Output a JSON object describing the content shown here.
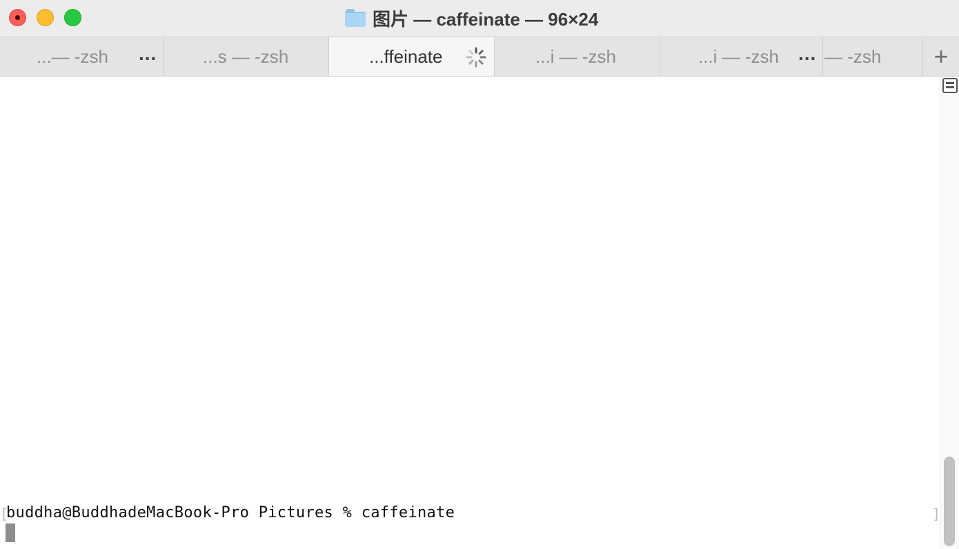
{
  "window": {
    "title": "图片 — caffeinate — 96×24",
    "folder_icon": "folder-icon"
  },
  "tabs": [
    {
      "label": "...— -zsh",
      "overflow": "..."
    },
    {
      "label": "...s — -zsh"
    },
    {
      "label": "...ffeinate",
      "active": true,
      "status_icon": "spinner-icon"
    },
    {
      "label": "...i — -zsh"
    },
    {
      "label": "...i — -zsh",
      "overflow": "..."
    },
    {
      "label": "— -zsh"
    }
  ],
  "new_tab": "+",
  "terminal": {
    "left_bracket": "[",
    "right_bracket": "]",
    "prompt_line": "buddha@BuddhadeMacBook-Pro Pictures % caffeinate"
  },
  "colors": {
    "close": "#ff5f57",
    "minimize": "#febc2e",
    "zoom": "#28c840",
    "titlebar": "#ececec",
    "tabbar": "#e4e4e4",
    "active_tab": "#f6f6f6"
  }
}
